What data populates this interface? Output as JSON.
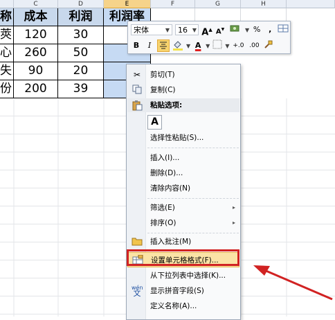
{
  "columns": [
    "C",
    "D",
    "E",
    "F",
    "G",
    "H"
  ],
  "table": {
    "headers": [
      "称",
      "成本",
      "利润",
      "利润率"
    ],
    "rows": [
      [
        "莢",
        "120",
        "30",
        ""
      ],
      [
        "心",
        "260",
        "50",
        ""
      ],
      [
        "失",
        "90",
        "20",
        ""
      ],
      [
        "份",
        "200",
        "39",
        ""
      ]
    ]
  },
  "minibar": {
    "font_name": "宋体",
    "font_size": "16",
    "grow_font": "A",
    "shrink_font": "A",
    "percent": "%",
    "comma": ",",
    "bold": "B",
    "italic": "I",
    "font_color": "A",
    "inc_decimal": "+.0",
    "dec_decimal": ".00"
  },
  "menu": {
    "cut": "剪切(T)",
    "copy": "复制(C)",
    "paste_options": "粘贴选项:",
    "paste_a": "A",
    "paste_special": "选择性粘贴(S)...",
    "insert": "插入(I)...",
    "delete": "删除(D)...",
    "clear": "清除内容(N)",
    "filter": "筛选(E)",
    "sort": "排序(O)",
    "insert_comment": "插入批注(M)",
    "format_cells": "设置单元格格式(F)...",
    "pick_list": "从下拉列表中选择(K)...",
    "phonetic": "显示拼音字段(S)",
    "define_name": "定义名称(A)...",
    "submenu_arrow": "▸"
  },
  "colors": {
    "highlight_border": "#d12222",
    "arrow": "#d12222",
    "menu_hover": "#fbe3a6",
    "header_fill": "#c8d8ec",
    "selected_col": "#c6daf3"
  }
}
